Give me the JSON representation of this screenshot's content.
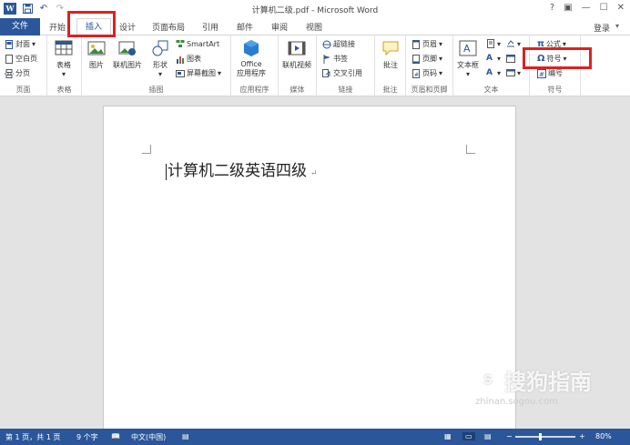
{
  "window": {
    "title": "计算机二级.pdf - Microsoft Word",
    "help": "?",
    "login": "登录"
  },
  "tabs": {
    "file": "文件",
    "items": [
      "开始",
      "插入",
      "设计",
      "页面布局",
      "引用",
      "邮件",
      "审阅",
      "视图"
    ],
    "active": "插入"
  },
  "ribbon": {
    "pages": {
      "label": "页面",
      "cover": "封面",
      "blank": "空白页",
      "break": "分页"
    },
    "tables": {
      "label": "表格",
      "table": "表格"
    },
    "illustrations": {
      "label": "插图",
      "picture": "图片",
      "online_picture": "联机图片",
      "shapes": "形状",
      "smartart": "SmartArt",
      "chart": "图表",
      "screenshot": "屏幕截图"
    },
    "apps": {
      "label": "应用程序",
      "office_line1": "Office",
      "office_line2": "应用程序"
    },
    "media": {
      "label": "媒体",
      "online_video": "联机视频"
    },
    "links": {
      "label": "链接",
      "hyperlink": "超链接",
      "bookmark": "书签",
      "cross_ref": "交叉引用"
    },
    "comments": {
      "label": "批注",
      "comment": "批注"
    },
    "header_footer": {
      "label": "页眉和页脚",
      "header": "页眉",
      "footer": "页脚",
      "page_number": "页码"
    },
    "text": {
      "label": "文本",
      "textbox": "文本框"
    },
    "symbols": {
      "label": "符号",
      "equation": "公式",
      "symbol": "符号",
      "numbering": "编号"
    }
  },
  "document": {
    "text": "计算机二级英语四级",
    "para_mark": "↵"
  },
  "statusbar": {
    "page": "第 1 页，共 1 页",
    "words": "9 个字",
    "language": "中文(中国)",
    "zoom": "80%",
    "zoom_minus": "−",
    "zoom_plus": "+"
  },
  "watermark": {
    "brand": "搜狗指南",
    "url": "zhinan.sogou.com"
  },
  "colors": {
    "accent": "#2b579a",
    "highlight": "#e02020"
  }
}
